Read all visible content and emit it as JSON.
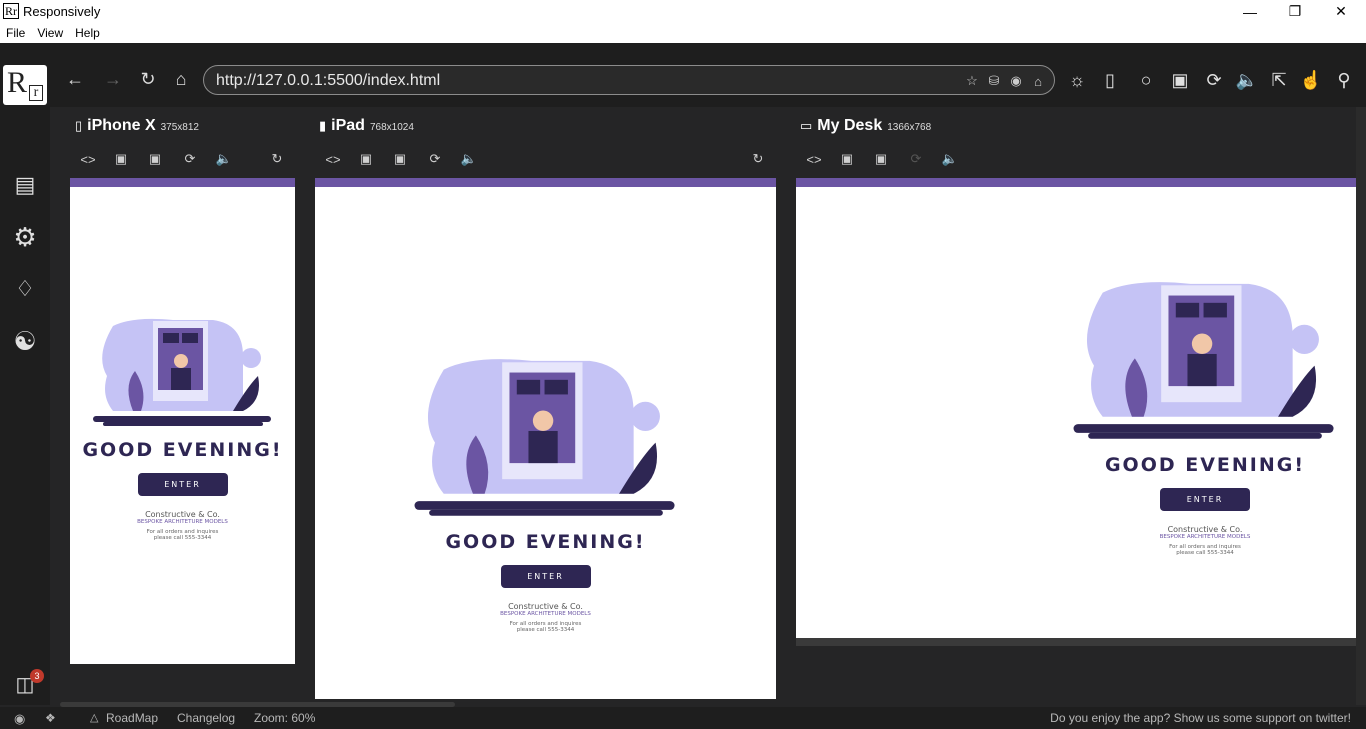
{
  "window": {
    "title": "Responsively",
    "app_icon": "Rr"
  },
  "menu": [
    "File",
    "View",
    "Help"
  ],
  "address_bar": {
    "url": "http://127.0.0.1:5500/index.html"
  },
  "logo": {
    "big": "R",
    "small": "r"
  },
  "sidebar_badge": "3",
  "devices": [
    {
      "icon": "mobile-icon",
      "name": "iPhone X",
      "size": "375x812"
    },
    {
      "icon": "tablet-icon",
      "name": "iPad",
      "size": "768x1024"
    },
    {
      "icon": "desktop-icon",
      "name": "My Desk",
      "size": "1366x768"
    }
  ],
  "page": {
    "greeting": "GOOD EVENING!",
    "button": "ENTER",
    "company": "Constructive & Co.",
    "tagline": "BESPOKE ARCHITETURE MODELS",
    "contact_line1": "For all orders and inquires",
    "contact_line2": "please call 555-3344"
  },
  "statusbar": {
    "roadmap": "RoadMap",
    "changelog": "Changelog",
    "zoom": "Zoom: 60%",
    "support": "Do you enjoy the app? Show us some support on twitter!"
  },
  "colors": {
    "accent": "#6b55a3",
    "dark_navy": "#2e2653",
    "lavender": "#c5c3f5",
    "chrome_bg": "#1e1e1e"
  }
}
